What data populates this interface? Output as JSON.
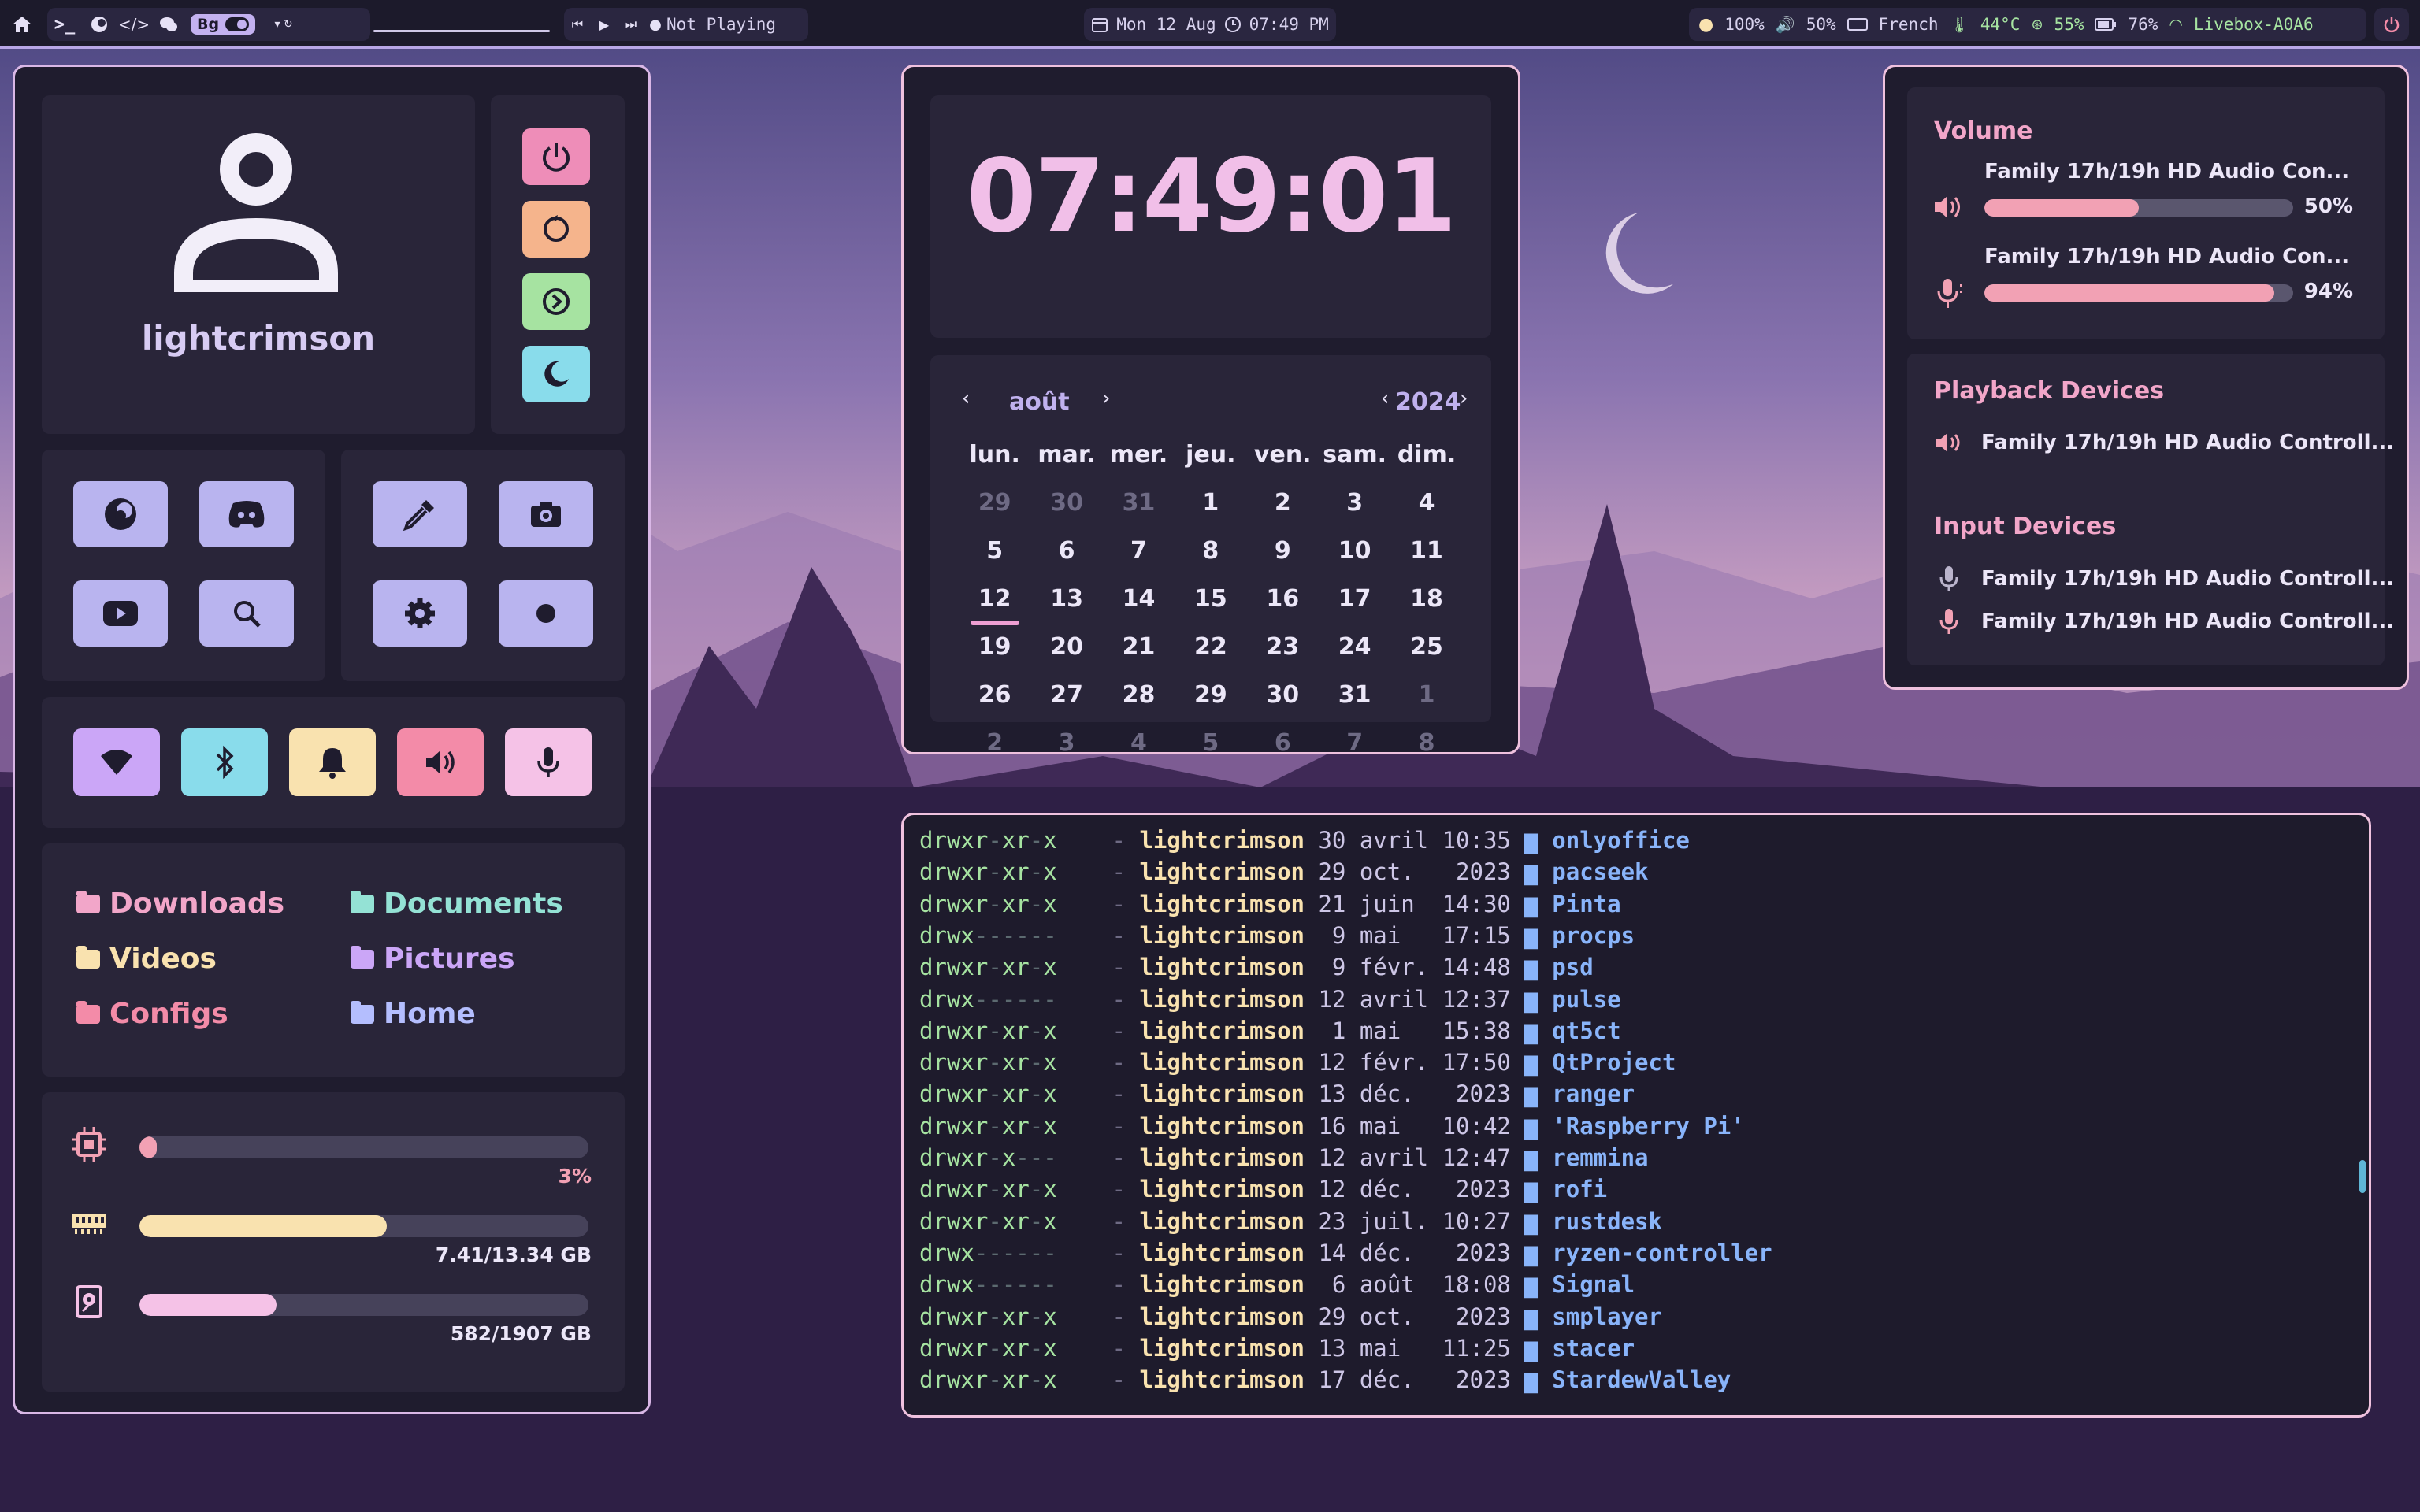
{
  "topbar": {
    "bg_label": "Bg",
    "media_status": "Not Playing",
    "date": "Mon 12 Aug",
    "time": "07:49 PM",
    "brightness": "100%",
    "volume": "50%",
    "keyboard_layout": "French",
    "temperature": "44°C",
    "cpu": "55%",
    "battery": "76%",
    "wifi": "Livebox-A0A6"
  },
  "profile": {
    "username": "lightcrimson"
  },
  "power_buttons": [
    {
      "icon": "power-icon",
      "color": "#ee8db8"
    },
    {
      "icon": "restart-icon",
      "color": "#f5b48c"
    },
    {
      "icon": "logout-icon",
      "color": "#a6e3a1"
    },
    {
      "icon": "sleep-icon",
      "color": "#89dceb"
    }
  ],
  "launchers": [
    "firefox-icon",
    "discord-icon",
    "color-picker-icon",
    "screenshot-icon",
    "youtube-icon",
    "search-icon",
    "settings-icon",
    "record-icon"
  ],
  "quick_toggles": [
    {
      "icon": "wifi-icon",
      "color": "#cba6f7"
    },
    {
      "icon": "bluetooth-icon",
      "color": "#89dceb"
    },
    {
      "icon": "bell-icon",
      "color": "#f9e2af"
    },
    {
      "icon": "speaker-icon",
      "color": "#f38ba8"
    },
    {
      "icon": "microphone-icon",
      "color": "#f5c2e7"
    }
  ],
  "folders": [
    {
      "label": "Downloads",
      "color": "#f2a6c9"
    },
    {
      "label": "Documents",
      "color": "#94e2d5"
    },
    {
      "label": "Videos",
      "color": "#f9e2af"
    },
    {
      "label": "Pictures",
      "color": "#cba6f7"
    },
    {
      "label": "Configs",
      "color": "#f38ba8"
    },
    {
      "label": "Home",
      "color": "#b4befe"
    }
  ],
  "system": {
    "cpu": {
      "fraction": 0.03,
      "label": "3%"
    },
    "ram": {
      "fraction": 0.55,
      "label": "7.41/13.34 GB"
    },
    "disk": {
      "fraction": 0.305,
      "label": "582/1907 GB"
    }
  },
  "clock": {
    "time": "07:49:01"
  },
  "calendar": {
    "month": "août",
    "year": "2024",
    "weekdays": [
      "lun.",
      "mar.",
      "mer.",
      "jeu.",
      "ven.",
      "sam.",
      "dim."
    ],
    "weeks": [
      [
        "29",
        "30",
        "31",
        "1",
        "2",
        "3",
        "4"
      ],
      [
        "5",
        "6",
        "7",
        "8",
        "9",
        "10",
        "11"
      ],
      [
        "12",
        "13",
        "14",
        "15",
        "16",
        "17",
        "18"
      ],
      [
        "19",
        "20",
        "21",
        "22",
        "23",
        "24",
        "25"
      ],
      [
        "26",
        "27",
        "28",
        "29",
        "30",
        "31",
        "1"
      ],
      [
        "2",
        "3",
        "4",
        "5",
        "6",
        "7",
        "8"
      ]
    ],
    "today": "12"
  },
  "volume_panel": {
    "title": "Volume",
    "output": {
      "device": "Family 17h/19h HD Audio Con...",
      "level": 0.5,
      "label": "50%"
    },
    "input": {
      "device": "Family 17h/19h HD Audio Con...",
      "level": 0.94,
      "label": "94%"
    },
    "playback_title": "Playback Devices",
    "playback_devices": [
      "Family 17h/19h HD Audio Controll..."
    ],
    "input_title": "Input Devices",
    "input_devices": [
      "Family 17h/19h HD Audio Controll...",
      "Family 17h/19h HD Audio Controll..."
    ]
  },
  "terminal": {
    "rows": [
      {
        "perm": "drwxr-xr-x",
        "user": "lightcrimson",
        "date": "30 avril 10:35",
        "name": "onlyoffice"
      },
      {
        "perm": "drwxr-xr-x",
        "user": "lightcrimson",
        "date": "29 oct.   2023",
        "name": "pacseek"
      },
      {
        "perm": "drwxr-xr-x",
        "user": "lightcrimson",
        "date": "21 juin  14:30",
        "name": "Pinta"
      },
      {
        "perm": "drwx------",
        "user": "lightcrimson",
        "date": " 9 mai   17:15",
        "name": "procps"
      },
      {
        "perm": "drwxr-xr-x",
        "user": "lightcrimson",
        "date": " 9 févr. 14:48",
        "name": "psd"
      },
      {
        "perm": "drwx------",
        "user": "lightcrimson",
        "date": "12 avril 12:37",
        "name": "pulse"
      },
      {
        "perm": "drwxr-xr-x",
        "user": "lightcrimson",
        "date": " 1 mai   15:38",
        "name": "qt5ct"
      },
      {
        "perm": "drwxr-xr-x",
        "user": "lightcrimson",
        "date": "12 févr. 17:50",
        "name": "QtProject"
      },
      {
        "perm": "drwxr-xr-x",
        "user": "lightcrimson",
        "date": "13 déc.   2023",
        "name": "ranger"
      },
      {
        "perm": "drwxr-xr-x",
        "user": "lightcrimson",
        "date": "16 mai   10:42",
        "name": "'Raspberry Pi'"
      },
      {
        "perm": "drwxr-x---",
        "user": "lightcrimson",
        "date": "12 avril 12:47",
        "name": "remmina"
      },
      {
        "perm": "drwxr-xr-x",
        "user": "lightcrimson",
        "date": "12 déc.   2023",
        "name": "rofi"
      },
      {
        "perm": "drwxr-xr-x",
        "user": "lightcrimson",
        "date": "23 juil. 10:27",
        "name": "rustdesk"
      },
      {
        "perm": "drwx------",
        "user": "lightcrimson",
        "date": "14 déc.   2023",
        "name": "ryzen-controller"
      },
      {
        "perm": "drwx------",
        "user": "lightcrimson",
        "date": " 6 août  18:08",
        "name": "Signal"
      },
      {
        "perm": "drwxr-xr-x",
        "user": "lightcrimson",
        "date": "29 oct.   2023",
        "name": "smplayer"
      },
      {
        "perm": "drwxr-xr-x",
        "user": "lightcrimson",
        "date": "13 mai   11:25",
        "name": "stacer"
      },
      {
        "perm": "drwxr-xr-x",
        "user": "lightcrimson",
        "date": "17 déc.   2023",
        "name": "StardewValley"
      }
    ],
    "size_dash": "-"
  }
}
